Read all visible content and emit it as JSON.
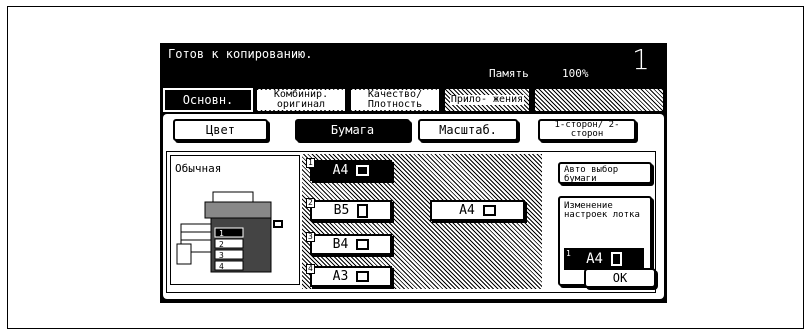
{
  "status": {
    "message": "Готов к копированию.",
    "memory_label": "Память",
    "memory_value": "100%",
    "copies": "1"
  },
  "top_tabs": [
    {
      "label": "Основн.",
      "active": true
    },
    {
      "label": "Комбинир. оригинал"
    },
    {
      "label": "Качество/ Плотность"
    },
    {
      "label": "Прило- жения"
    }
  ],
  "sub_tabs": [
    {
      "label": "Цвет"
    },
    {
      "label": "Бумага",
      "active": true
    },
    {
      "label": "Масштаб."
    },
    {
      "label": "1-сторон/ 2-сторон"
    }
  ],
  "paper_type": "Обычная",
  "trays": [
    {
      "num": "1",
      "size": "A4",
      "orientation": "landscape",
      "selected": true
    },
    {
      "num": "2",
      "size": "B5",
      "orientation": "portrait"
    },
    {
      "num": "3",
      "size": "B4",
      "orientation": "landscape"
    },
    {
      "num": "4",
      "size": "A3",
      "orientation": "landscape"
    },
    {
      "num": "",
      "size": "A4",
      "orientation": "landscape",
      "bypass": true
    }
  ],
  "machine_tray_labels": [
    "1",
    "2",
    "3",
    "4"
  ],
  "buttons": {
    "auto_paper": "Авто выбор бумаги",
    "change_tray": "Изменение настроек лотка",
    "selected_tray_num": "1",
    "selected_tray_size": "A4",
    "ok": "OK"
  }
}
